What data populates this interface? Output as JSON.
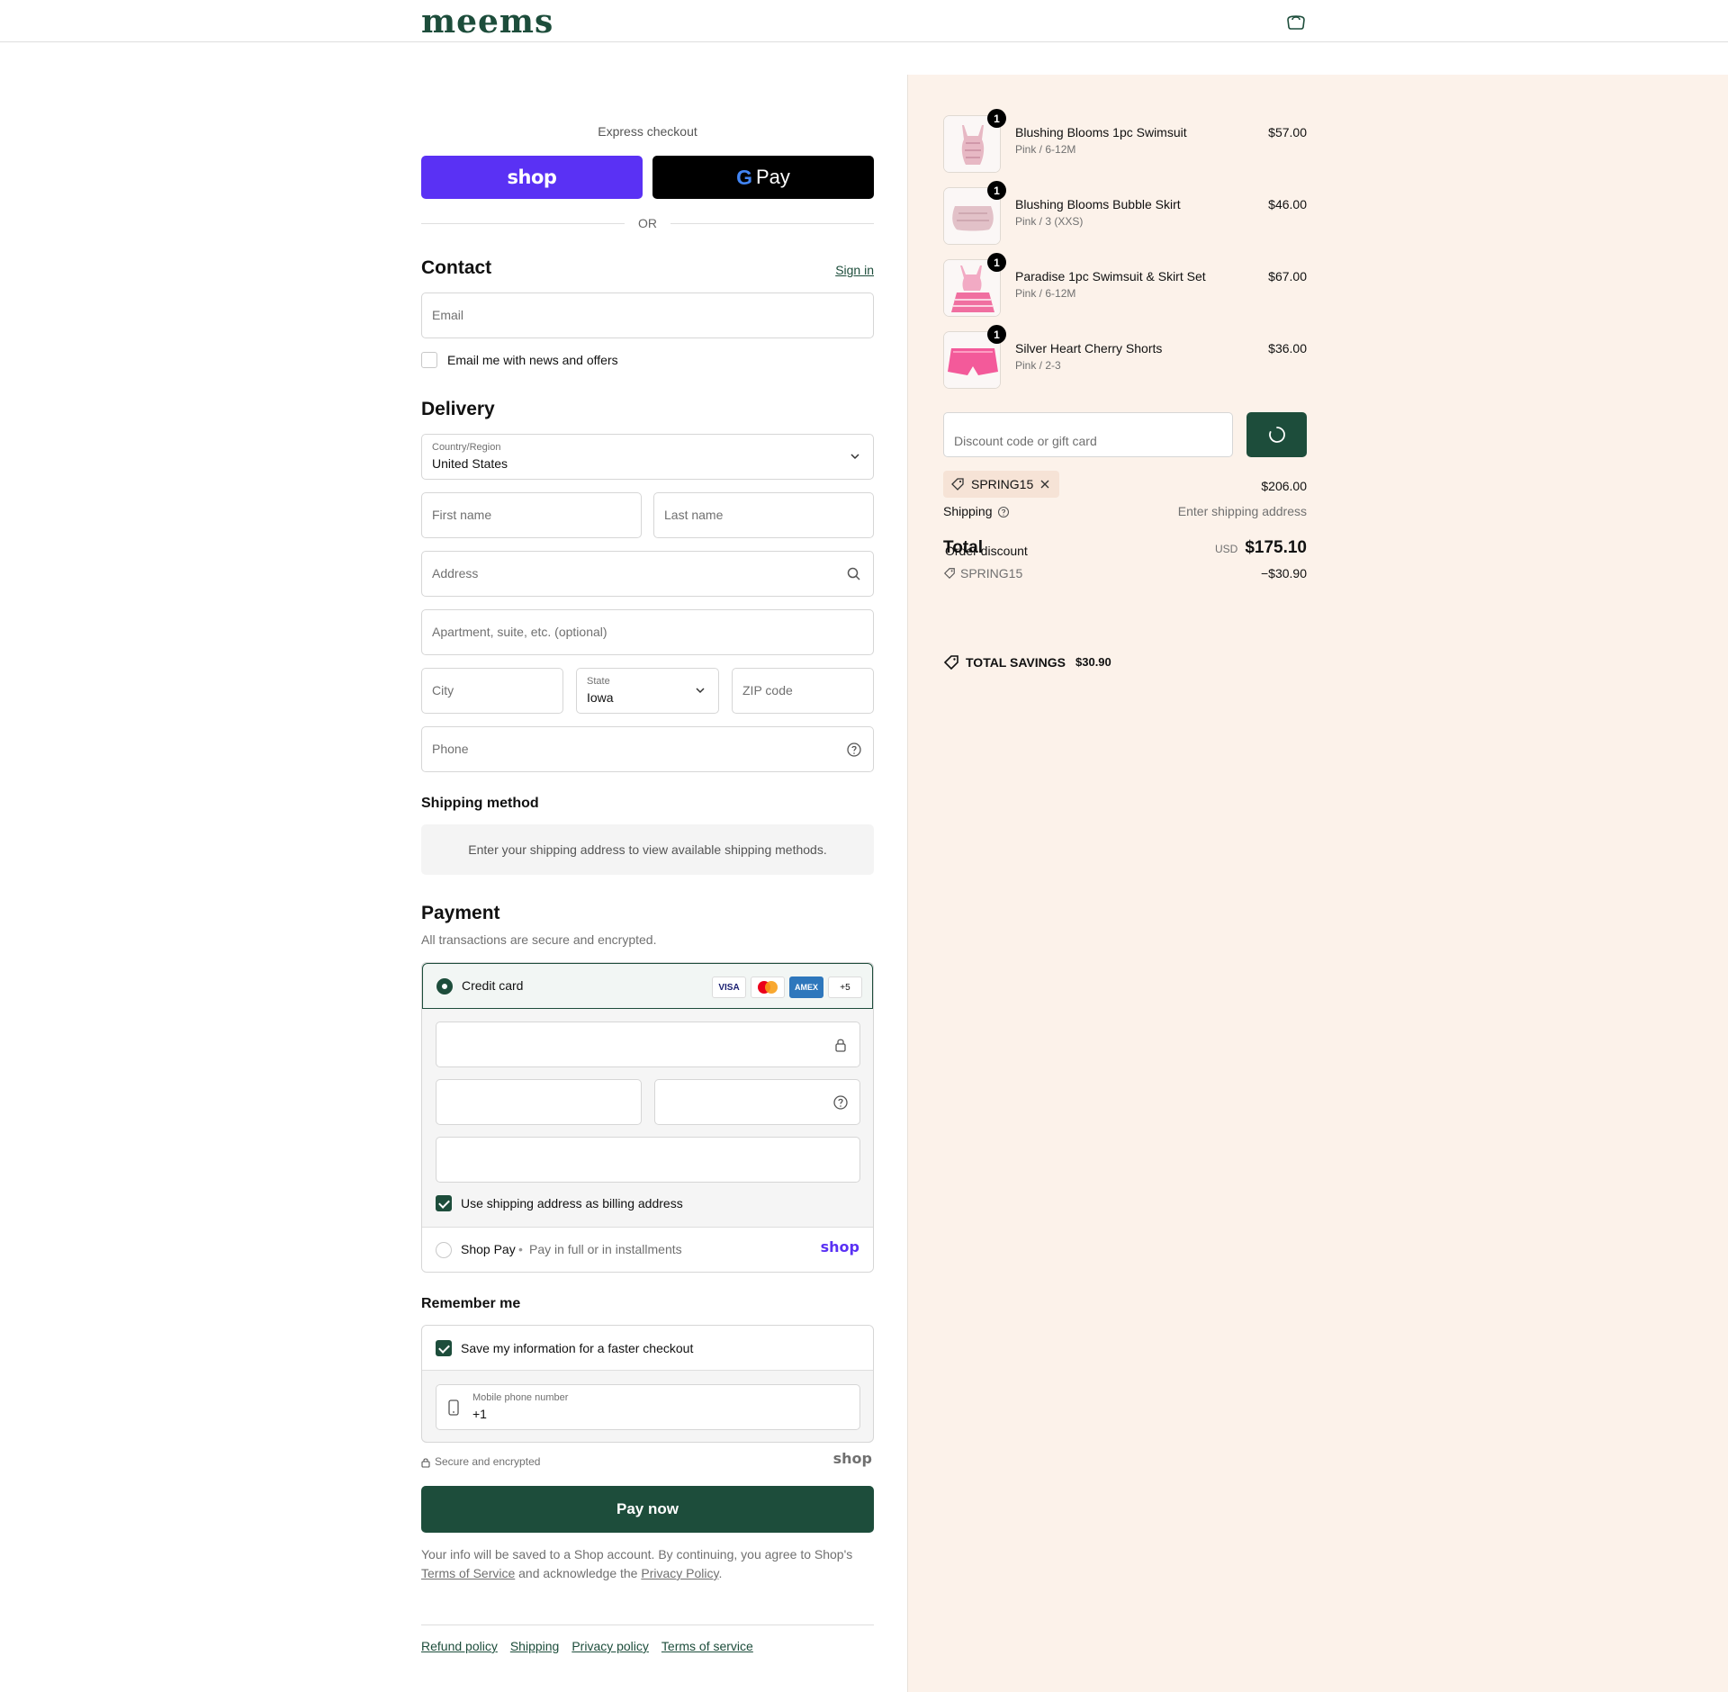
{
  "header": {
    "logo": "meems",
    "bag_icon": "shopping-bag-icon"
  },
  "express": {
    "title": "Express checkout",
    "shop_label": "shop",
    "gpay_g": "G",
    "gpay_label": "Pay",
    "or": "OR"
  },
  "contact": {
    "heading": "Contact",
    "sign_in": "Sign in",
    "email_placeholder": "Email",
    "news_label": "Email me with news and offers"
  },
  "delivery": {
    "heading": "Delivery",
    "country_label": "Country/Region",
    "country_value": "United States",
    "first_name": "First name",
    "last_name": "Last name",
    "address": "Address",
    "apartment": "Apartment, suite, etc. (optional)",
    "city": "City",
    "state_label": "State",
    "state_value": "Iowa",
    "zip": "ZIP code",
    "phone": "Phone"
  },
  "shipping_method": {
    "heading": "Shipping method",
    "message": "Enter your shipping address to view available shipping methods."
  },
  "payment": {
    "heading": "Payment",
    "subtext": "All transactions are secure and encrypted.",
    "credit_card": "Credit card",
    "cards": [
      "VISA",
      "MC",
      "AMEX",
      "+5"
    ],
    "billing_label": "Use shipping address as billing address",
    "shop_pay": "Shop Pay",
    "shop_pay_sub": "Pay in full or in installments",
    "shop_logo": "shop"
  },
  "remember": {
    "heading": "Remember me",
    "save_label": "Save my information for a faster checkout",
    "mobile_label": "Mobile phone number",
    "mobile_value": "+1",
    "secure": "Secure and encrypted",
    "shop_logo": "shop"
  },
  "pay_now": "Pay now",
  "legal": {
    "part1": "Your info will be saved to a Shop account. By continuing, you agree to Shop's ",
    "tos": "Terms of Service",
    "part2": " and acknowledge the ",
    "privacy": "Privacy Policy",
    "part3": "."
  },
  "footer": [
    "Refund policy",
    "Shipping",
    "Privacy policy",
    "Terms of service"
  ],
  "cart": {
    "items": [
      {
        "name": "Blushing Blooms 1pc Swimsuit",
        "variant": "Pink / 6-12M",
        "price": "$57.00",
        "qty": "1"
      },
      {
        "name": "Blushing Blooms Bubble Skirt",
        "variant": "Pink / 3 (XXS)",
        "price": "$46.00",
        "qty": "1"
      },
      {
        "name": "Paradise 1pc Swimsuit & Skirt Set",
        "variant": "Pink / 6-12M",
        "price": "$67.00",
        "qty": "1"
      },
      {
        "name": "Silver Heart Cherry Shorts",
        "variant": "Pink / 2-3",
        "price": "$36.00",
        "qty": "1"
      }
    ],
    "discount_placeholder": "Discount code or gift card",
    "code_chip": "SPRING15",
    "subtotal_value": "$206.00",
    "shipping_label": "Shipping",
    "shipping_value": "Enter shipping address",
    "total_label": "Total",
    "order_discount_label": "Order discount",
    "currency": "USD",
    "total_value": "$175.10",
    "discount_code": "SPRING15",
    "discount_value": "−$30.90",
    "savings_label": "TOTAL SAVINGS",
    "savings_value": "$30.90"
  },
  "colors": {
    "brand": "#1d4d3b",
    "shop_purple": "#5a31f4",
    "summary_bg": "#fcf2ea"
  }
}
